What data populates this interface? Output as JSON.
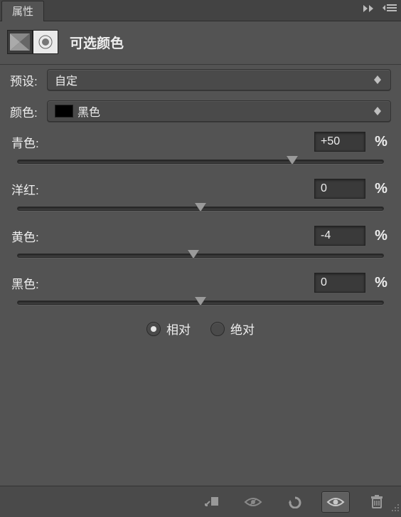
{
  "panel": {
    "title": "属性"
  },
  "adjustment": {
    "name": "可选颜色"
  },
  "preset": {
    "label": "预设:",
    "value": "自定"
  },
  "colorSelect": {
    "label": "颜色:",
    "value": "黑色",
    "swatch": "#000000"
  },
  "sliders": {
    "cyan": {
      "label": "青色:",
      "value": "+50",
      "pos": 75
    },
    "magenta": {
      "label": "洋红:",
      "value": "0",
      "pos": 50
    },
    "yellow": {
      "label": "黄色:",
      "value": "-4",
      "pos": 48
    },
    "black": {
      "label": "黑色:",
      "value": "0",
      "pos": 50
    }
  },
  "mode": {
    "relative": {
      "label": "相对",
      "checked": true
    },
    "absolute": {
      "label": "绝对",
      "checked": false
    }
  },
  "unit": "%"
}
